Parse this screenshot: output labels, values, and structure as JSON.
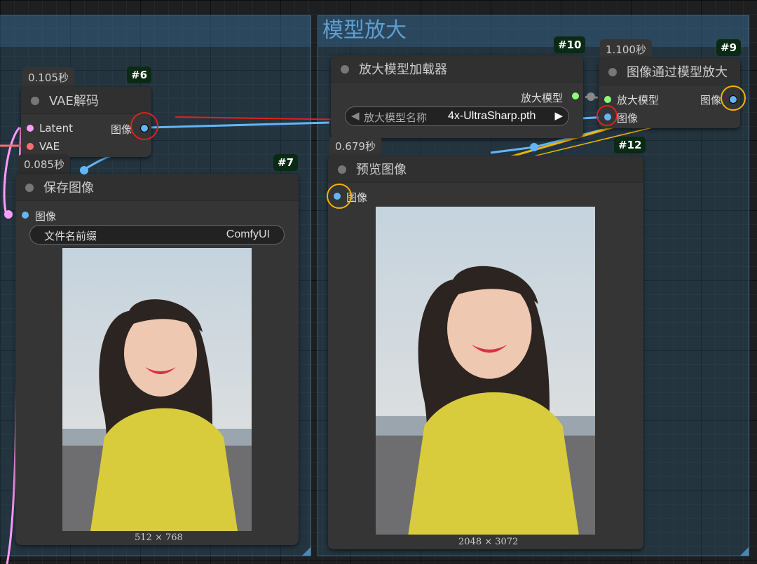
{
  "group": {
    "title": "模型放大"
  },
  "nodes": {
    "vae_decode": {
      "time": "0.105秒",
      "id": "#6",
      "title": "VAE解码",
      "input1": "Latent",
      "input2": "VAE",
      "output": "图像"
    },
    "save_image": {
      "time": "0.085秒",
      "id": "#7",
      "title": "保存图像",
      "input": "图像",
      "prefix_label": "文件名前缀",
      "prefix_value": "ComfyUI",
      "dims": "512 × 768"
    },
    "upscale_loader": {
      "id": "#10",
      "title": "放大模型加载器",
      "output": "放大模型",
      "model_label": "放大模型名称",
      "model_value": "4x-UltraSharp.pth"
    },
    "upscale_by_model": {
      "time": "1.100秒",
      "id": "#9",
      "title": "图像通过模型放大",
      "input1": "放大模型",
      "input2": "图像",
      "output": "图像"
    },
    "preview_image": {
      "time": "0.679秒",
      "id": "#12",
      "title": "预览图像",
      "input": "图像",
      "dims": "2048 × 3072"
    }
  },
  "colors": {
    "image_slot": "#64b5f6",
    "latent_slot": "#ff9cf9",
    "vae_slot": "#ff6e6e",
    "model_slot": "#8eff7a",
    "annotation_red": "#e02020",
    "annotation_yellow": "#f5b400"
  },
  "icons": {
    "arrow_left": "◀",
    "arrow_right": "▶"
  }
}
